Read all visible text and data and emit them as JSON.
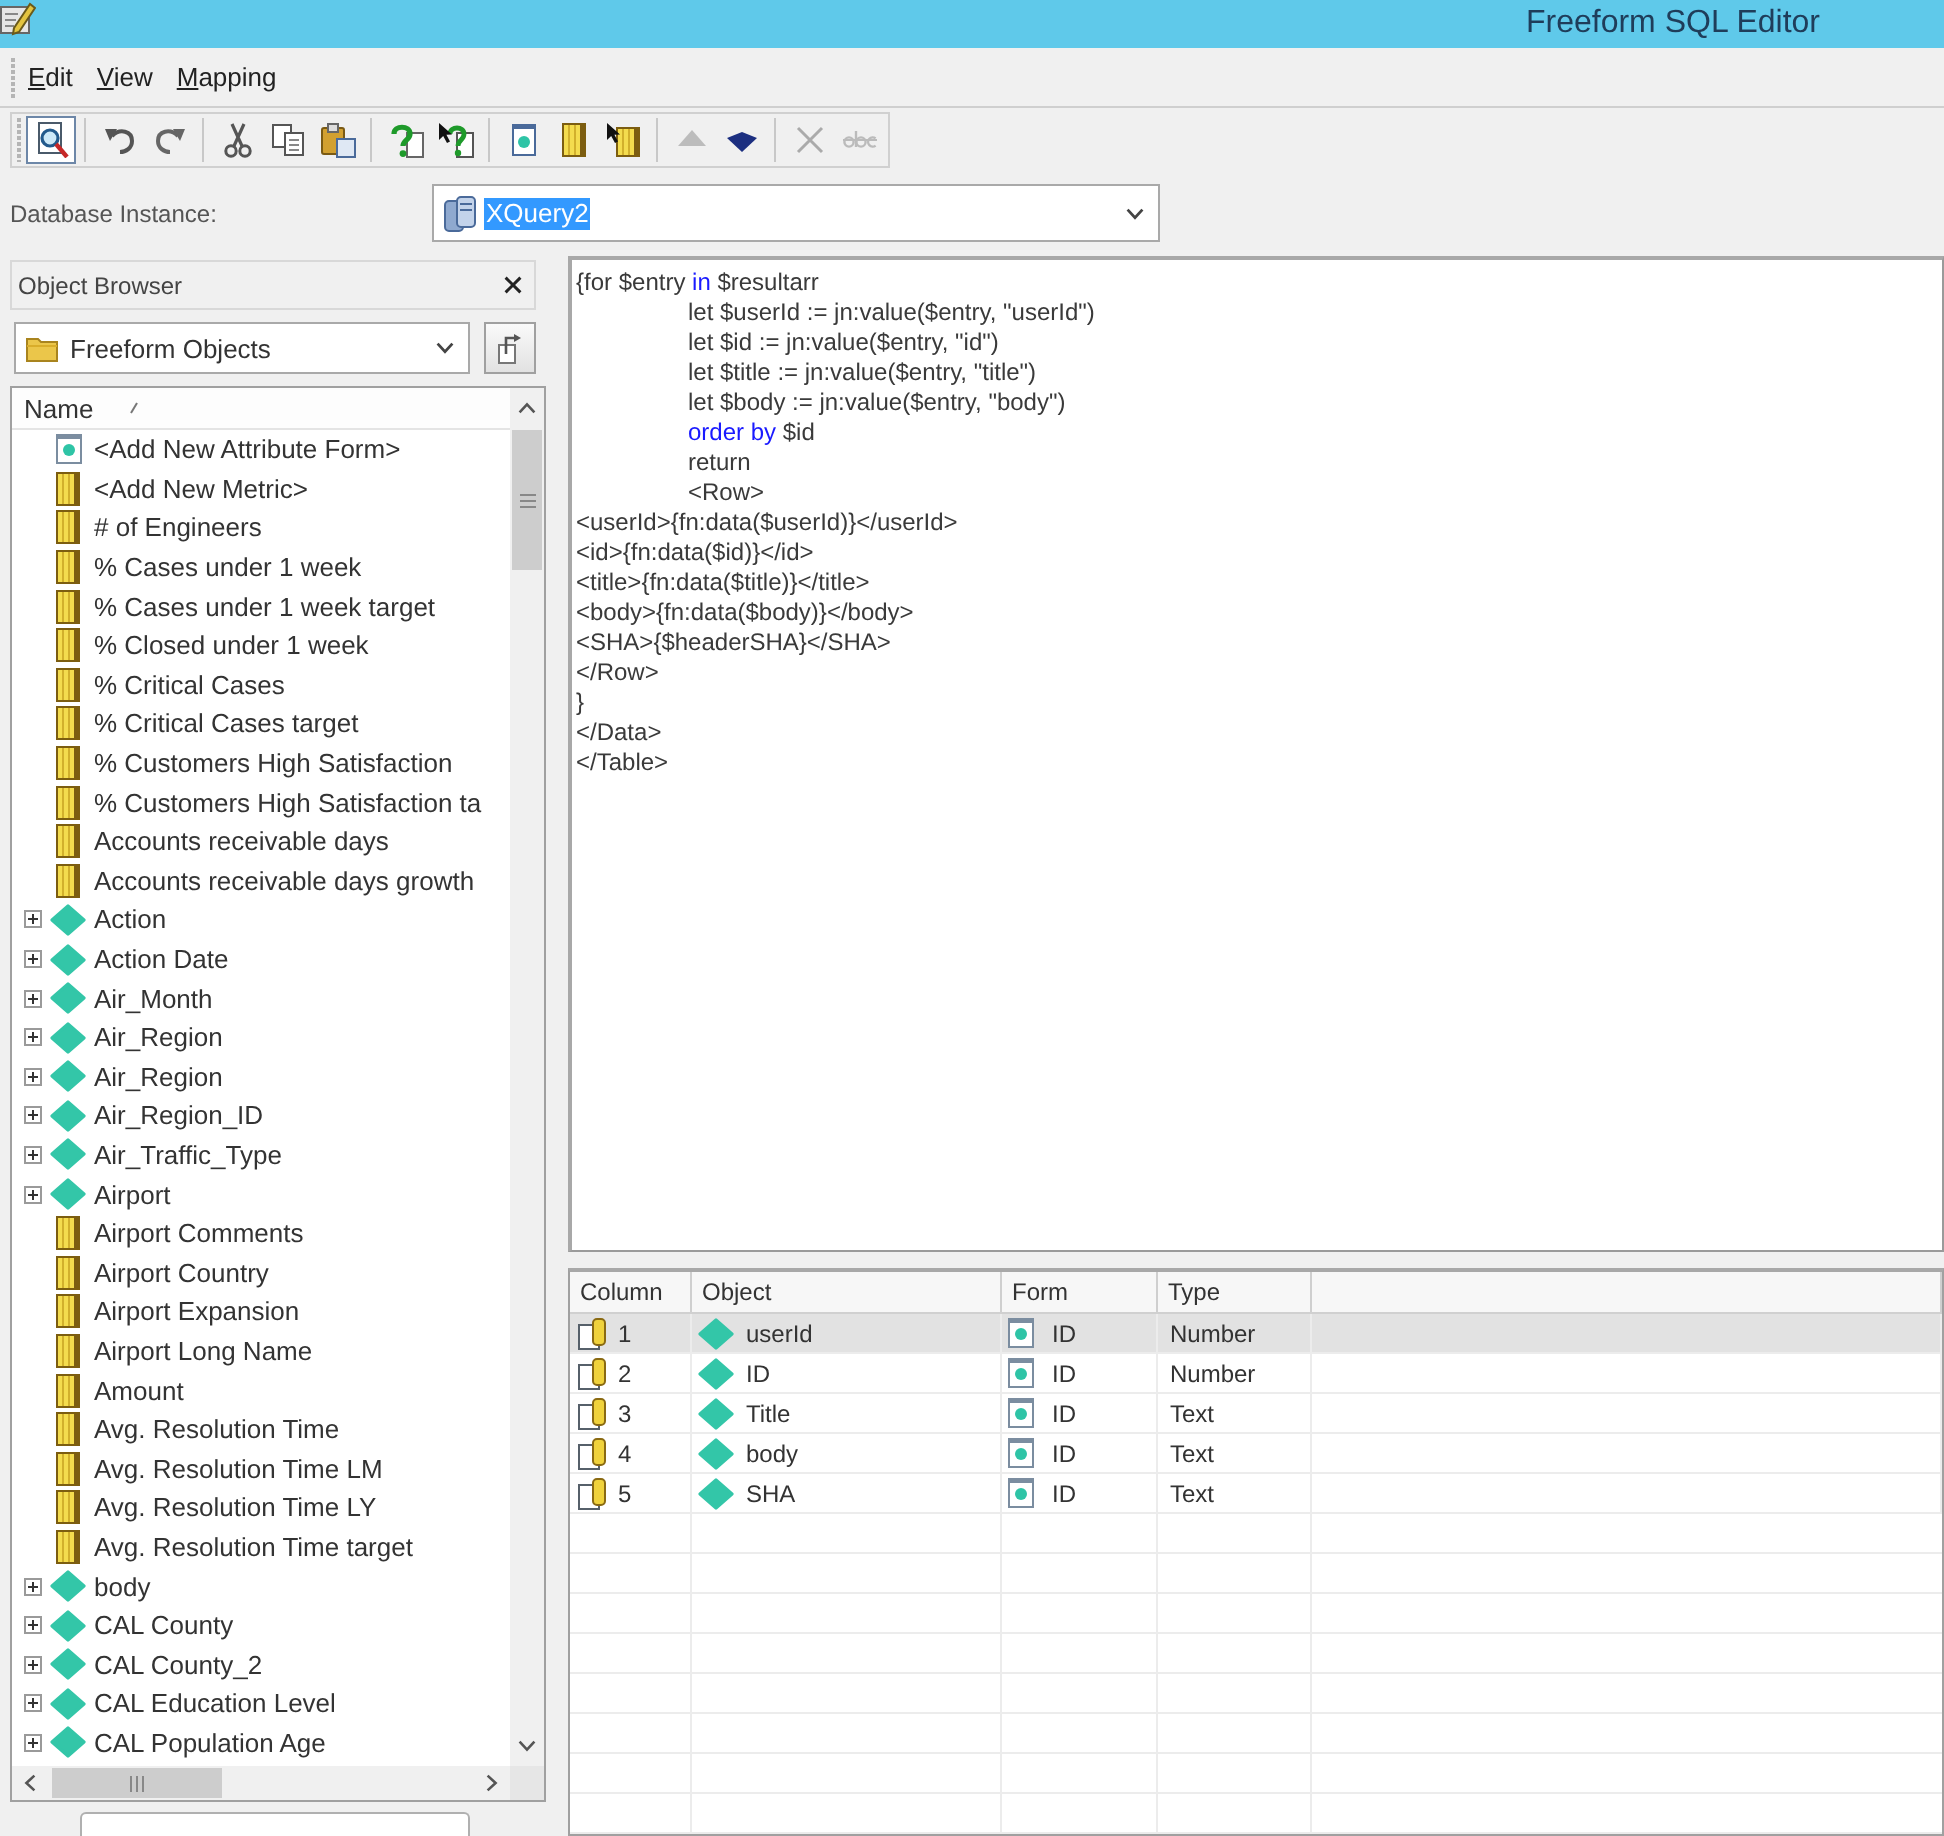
{
  "window": {
    "title": "Freeform SQL Editor"
  },
  "menu": [
    "Edit",
    "View",
    "Mapping"
  ],
  "toolbar": {
    "groups": [
      {
        "items": [
          {
            "kind": "preview",
            "pressed": true,
            "disabled": false
          }
        ]
      },
      {
        "items": [
          {
            "kind": "undo",
            "pressed": false,
            "disabled": false
          },
          {
            "kind": "redo",
            "pressed": false,
            "disabled": false
          }
        ]
      },
      {
        "items": [
          {
            "kind": "cut",
            "pressed": false,
            "disabled": false
          },
          {
            "kind": "copy",
            "pressed": false,
            "disabled": false
          },
          {
            "kind": "paste",
            "pressed": false,
            "disabled": false
          }
        ]
      },
      {
        "items": [
          {
            "kind": "help",
            "pressed": false,
            "disabled": false
          },
          {
            "kind": "context-help",
            "pressed": false,
            "disabled": false
          }
        ]
      },
      {
        "items": [
          {
            "kind": "attribute-form",
            "pressed": false,
            "disabled": false
          },
          {
            "kind": "metric",
            "pressed": false,
            "disabled": false
          },
          {
            "kind": "metric-pointer",
            "pressed": false,
            "disabled": false
          }
        ]
      },
      {
        "items": [
          {
            "kind": "move-up",
            "pressed": false,
            "disabled": true
          },
          {
            "kind": "move-down",
            "pressed": false,
            "disabled": false
          }
        ]
      },
      {
        "items": [
          {
            "kind": "delete",
            "pressed": false,
            "disabled": true
          },
          {
            "kind": "spell-check",
            "pressed": false,
            "disabled": true
          }
        ]
      }
    ]
  },
  "database_instance": {
    "label": "Database Instance:",
    "value": "XQuery2",
    "text_selected": true
  },
  "object_browser": {
    "title": "Object Browser",
    "folder": "Freeform Objects",
    "column": "Name",
    "items": [
      {
        "label": "<Add New Attribute Form>",
        "kind": "form",
        "selected": false
      },
      {
        "label": "<Add New Metric>",
        "kind": "metric",
        "selected": false
      },
      {
        "label": "# of Engineers",
        "kind": "metric",
        "selected": false
      },
      {
        "label": "% Cases under 1 week",
        "kind": "metric",
        "selected": false
      },
      {
        "label": "% Cases under 1 week target",
        "kind": "metric",
        "selected": false
      },
      {
        "label": "% Closed under 1 week",
        "kind": "metric",
        "selected": false
      },
      {
        "label": "% Critical Cases",
        "kind": "metric",
        "selected": false
      },
      {
        "label": "% Critical Cases target",
        "kind": "metric",
        "selected": false
      },
      {
        "label": "% Customers High Satisfaction",
        "kind": "metric",
        "selected": false
      },
      {
        "label": "% Customers High Satisfaction ta",
        "kind": "metric",
        "selected": false
      },
      {
        "label": "Accounts receivable days",
        "kind": "metric",
        "selected": false
      },
      {
        "label": "Accounts receivable days growth",
        "kind": "metric",
        "selected": false
      },
      {
        "label": "Action",
        "kind": "attribute",
        "expanded": false,
        "selected": false
      },
      {
        "label": "Action Date",
        "kind": "attribute",
        "expanded": false,
        "selected": false
      },
      {
        "label": "Air_Month",
        "kind": "attribute",
        "expanded": false,
        "selected": false
      },
      {
        "label": "Air_Region",
        "kind": "attribute",
        "expanded": false,
        "selected": false
      },
      {
        "label": "Air_Region",
        "kind": "attribute",
        "expanded": false,
        "selected": false
      },
      {
        "label": "Air_Region_ID",
        "kind": "attribute",
        "expanded": false,
        "selected": false
      },
      {
        "label": "Air_Traffic_Type",
        "kind": "attribute",
        "expanded": false,
        "selected": false
      },
      {
        "label": "Airport",
        "kind": "attribute",
        "expanded": false,
        "selected": false
      },
      {
        "label": "Airport Comments",
        "kind": "metric",
        "selected": false
      },
      {
        "label": "Airport Country",
        "kind": "metric",
        "selected": false
      },
      {
        "label": "Airport Expansion",
        "kind": "metric",
        "selected": false
      },
      {
        "label": "Airport Long Name",
        "kind": "metric",
        "selected": false
      },
      {
        "label": "Amount",
        "kind": "metric",
        "selected": false
      },
      {
        "label": "Avg. Resolution Time",
        "kind": "metric",
        "selected": false
      },
      {
        "label": "Avg. Resolution Time LM",
        "kind": "metric",
        "selected": false
      },
      {
        "label": "Avg. Resolution Time LY",
        "kind": "metric",
        "selected": false
      },
      {
        "label": "Avg. Resolution Time target",
        "kind": "metric",
        "selected": false
      },
      {
        "label": "body",
        "kind": "attribute",
        "expanded": false,
        "selected": false
      },
      {
        "label": "CAL County",
        "kind": "attribute",
        "expanded": false,
        "selected": false
      },
      {
        "label": "CAL County_2",
        "kind": "attribute",
        "expanded": false,
        "selected": false
      },
      {
        "label": "CAL Education Level",
        "kind": "attribute",
        "expanded": false,
        "selected": false
      },
      {
        "label": "CAL Population Age",
        "kind": "attribute",
        "expanded": false,
        "selected": false
      }
    ]
  },
  "editor": {
    "lines": [
      {
        "parts": [
          {
            "text": "{for $entry ",
            "kind": "plain"
          },
          {
            "text": "in",
            "kind": "keyword"
          },
          {
            "text": " $resultarr",
            "kind": "plain"
          }
        ],
        "children": [
          {
            "parts": [
              {
                "text": "let $userId := jn:value($entry, \"userId\")",
                "kind": "plain"
              }
            ]
          },
          {
            "parts": [
              {
                "text": "let $id := jn:value($entry, \"id\")",
                "kind": "plain"
              }
            ]
          },
          {
            "parts": [
              {
                "text": "let $title := jn:value($entry, \"title\")",
                "kind": "plain"
              }
            ]
          },
          {
            "parts": [
              {
                "text": "let $body := jn:value($entry, \"body\")",
                "kind": "plain"
              }
            ]
          },
          {
            "parts": [
              {
                "text": "order by",
                "kind": "keyword"
              },
              {
                "text": " $id",
                "kind": "plain"
              }
            ]
          },
          {
            "parts": [
              {
                "text": "return",
                "kind": "plain"
              }
            ]
          },
          {
            "parts": [
              {
                "text": "<Row>",
                "kind": "plain"
              }
            ]
          }
        ]
      },
      {
        "parts": [
          {
            "text": "<userId>{fn:data($userId)}</userId>",
            "kind": "plain"
          }
        ]
      },
      {
        "parts": [
          {
            "text": "<id>{fn:data($id)}</id>",
            "kind": "plain"
          }
        ]
      },
      {
        "parts": [
          {
            "text": "<title>{fn:data($title)}</title>",
            "kind": "plain"
          }
        ]
      },
      {
        "parts": [
          {
            "text": "<body>{fn:data($body)}</body>",
            "kind": "plain"
          }
        ]
      },
      {
        "parts": [
          {
            "text": "<SHA>{$headerSHA}</SHA>",
            "kind": "plain"
          }
        ]
      },
      {
        "parts": [
          {
            "text": "</Row>",
            "kind": "plain"
          }
        ]
      },
      {
        "parts": [
          {
            "text": "}",
            "kind": "plain"
          }
        ]
      },
      {
        "parts": [
          {
            "text": "</Data>",
            "kind": "plain"
          }
        ]
      },
      {
        "parts": [
          {
            "text": "</Table>",
            "kind": "plain"
          }
        ]
      }
    ]
  },
  "mapping_table": {
    "columns": [
      "Column",
      "Object",
      "Form",
      "Type"
    ],
    "rows": [
      {
        "column": "1",
        "object": "userId",
        "form": "ID",
        "type": "Number",
        "selected": true
      },
      {
        "column": "2",
        "object": "ID",
        "form": "ID",
        "type": "Number",
        "selected": false
      },
      {
        "column": "3",
        "object": "Title",
        "form": "ID",
        "type": "Text",
        "selected": false
      },
      {
        "column": "4",
        "object": "body",
        "form": "ID",
        "type": "Text",
        "selected": false
      },
      {
        "column": "5",
        "object": "SHA",
        "form": "ID",
        "type": "Text",
        "selected": false
      }
    ]
  }
}
